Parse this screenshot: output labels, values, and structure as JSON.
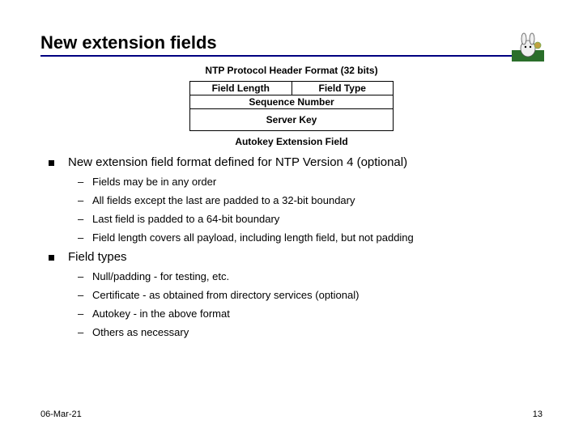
{
  "title": "New extension fields",
  "header_caption": "NTP Protocol Header Format (32 bits)",
  "packet": {
    "row0_left": "Field Length",
    "row0_right": "Field Type",
    "row1": "Sequence Number",
    "row2": "Server Key"
  },
  "subcaption": "Autokey Extension Field",
  "bullets": [
    {
      "text": "New extension field format defined for NTP Version 4 (optional)",
      "sub": [
        "Fields may be in any order",
        "All fields except the last are padded to a 32-bit boundary",
        "Last field is padded to a 64-bit boundary",
        "Field length covers all payload, including length field, but not padding"
      ]
    },
    {
      "text": "Field types",
      "sub": [
        "Null/padding - for testing, etc.",
        "Certificate - as obtained from directory services (optional)",
        "Autokey - in the above format",
        "Others as necessary"
      ]
    }
  ],
  "footer": {
    "date": "06-Mar-21",
    "page": "13"
  }
}
